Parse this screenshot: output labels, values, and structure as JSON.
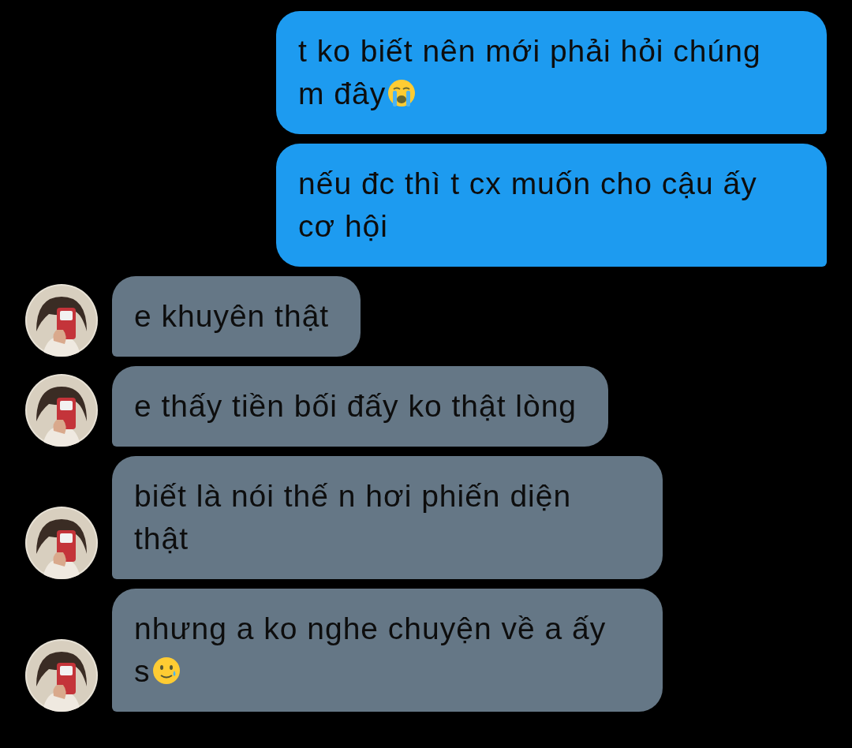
{
  "messages": [
    {
      "kind": "sent",
      "text": "t ko biết nên mới phải hỏi chúng m đây",
      "emoji": {
        "kind": "crying"
      }
    },
    {
      "kind": "sent",
      "text": "nếu đc thì t cx muốn cho cậu ấy cơ hội"
    },
    {
      "kind": "received",
      "text": "e khuyên thật"
    },
    {
      "kind": "received",
      "text": "e thấy tiền bối đấy ko thật lòng"
    },
    {
      "kind": "received",
      "text": "biết là nói thế n hơi phiến diện thật"
    },
    {
      "kind": "received",
      "text": "nhưng a ko nghe chuyện về a ấy s",
      "emoji": {
        "kind": "smiling-tear"
      }
    }
  ]
}
